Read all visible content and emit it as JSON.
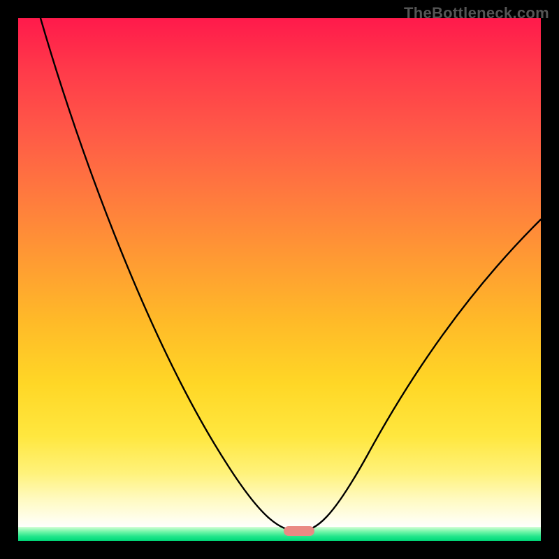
{
  "attribution": "TheBottleneck.com",
  "colors": {
    "frame": "#000000",
    "attribution_text": "#555555",
    "marker": "#ea8a84",
    "curve": "#000000",
    "gradient_top": "#ff1a4b",
    "gradient_bottom": "#00d878"
  },
  "chart_data": {
    "type": "line",
    "title": "",
    "xlabel": "",
    "ylabel": "",
    "xlim": [
      0,
      100
    ],
    "ylim": [
      0,
      100
    ],
    "grid": false,
    "legend": false,
    "series": [
      {
        "name": "bottleneck-curve",
        "x": [
          0,
          8,
          16,
          24,
          32,
          40,
          46,
          50,
          54,
          58,
          62,
          68,
          76,
          84,
          92,
          100
        ],
        "y": [
          100,
          83,
          66,
          50,
          35,
          20,
          9,
          3,
          0,
          3,
          9,
          20,
          34,
          48,
          58,
          64
        ]
      }
    ],
    "optimal_marker": {
      "x": 54,
      "y": 0
    },
    "notes": "V-shaped bottleneck curve on a red-to-green vertical gradient. Minimum (pink pill marker) near x≈54 at y=0. Values estimated from pixels; no axis ticks or labels present."
  }
}
